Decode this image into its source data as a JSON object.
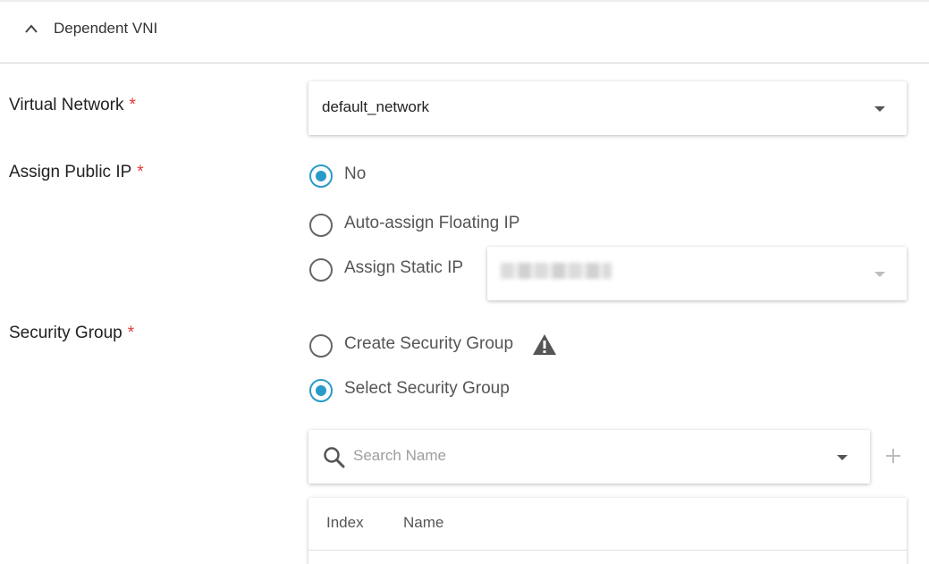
{
  "section": {
    "title": "Dependent VNI"
  },
  "virtual_network": {
    "label": "Virtual Network",
    "required_mark": "*",
    "selected": "default_network"
  },
  "assign_public_ip": {
    "label": "Assign Public IP",
    "required_mark": "*",
    "options": [
      {
        "label": "No",
        "checked": true
      },
      {
        "label": "Auto-assign Floating IP",
        "checked": false
      },
      {
        "label": "Assign Static IP",
        "checked": false
      }
    ]
  },
  "security_group": {
    "label": "Security Group",
    "required_mark": "*",
    "options": [
      {
        "label": "Create Security Group",
        "checked": false
      },
      {
        "label": "Select Security Group",
        "checked": true
      }
    ],
    "search": {
      "placeholder": "Search Name",
      "value": ""
    },
    "table": {
      "columns": [
        "Index",
        "Name"
      ]
    }
  },
  "colors": {
    "accent": "#2a9bc7",
    "required": "#e53935"
  }
}
